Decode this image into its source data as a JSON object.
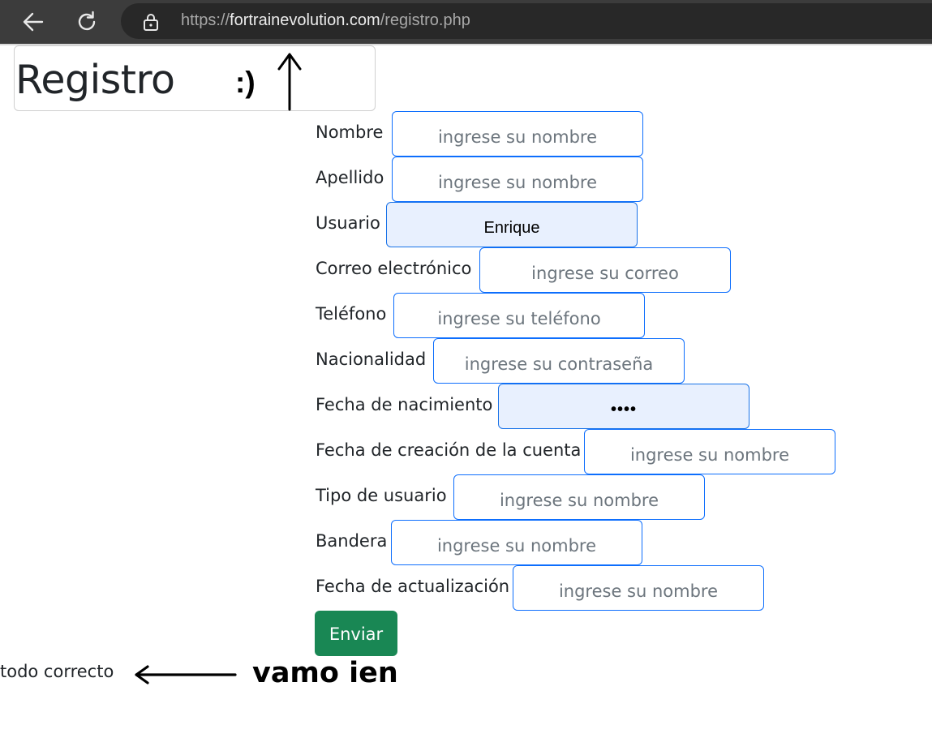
{
  "browser": {
    "url_scheme": "https://",
    "url_domain": "fortrainevolution.com",
    "url_path": "/registro.php",
    "icons": [
      "back-arrow-icon",
      "reload-icon",
      "lock-icon"
    ]
  },
  "header": {
    "title": "Registro",
    "smiley": ":)"
  },
  "form": {
    "fields": [
      {
        "label": "Nombre",
        "placeholder": "ingrese su nombre",
        "value": ""
      },
      {
        "label": "Apellido",
        "placeholder": "ingrese su nombre",
        "value": ""
      },
      {
        "label": "Usuario",
        "placeholder": "",
        "value": "Enrique"
      },
      {
        "label": "Correo electrónico",
        "placeholder": "ingrese su correo",
        "value": ""
      },
      {
        "label": "Teléfono",
        "placeholder": "ingrese su teléfono",
        "value": ""
      },
      {
        "label": "Nacionalidad",
        "placeholder": "ingrese su contraseña",
        "value": ""
      },
      {
        "label": "Fecha de nacimiento",
        "placeholder": "",
        "value": "••••"
      },
      {
        "label": "Fecha de creación de la cuenta",
        "placeholder": "ingrese su nombre",
        "value": ""
      },
      {
        "label": "Tipo de usuario",
        "placeholder": "ingrese su nombre",
        "value": ""
      },
      {
        "label": "Bandera",
        "placeholder": "ingrese su nombre",
        "value": ""
      },
      {
        "label": "Fecha de actualización",
        "placeholder": "ingrese su nombre",
        "value": ""
      }
    ],
    "submit_label": "Enviar"
  },
  "status_text": "todo correcto",
  "annotation_text": "vamo ien",
  "colors": {
    "toolbar": "#3c3c3c",
    "input_border": "#0d6efd",
    "autofill_bg": "#e8f0fe",
    "submit_bg": "#198754"
  }
}
